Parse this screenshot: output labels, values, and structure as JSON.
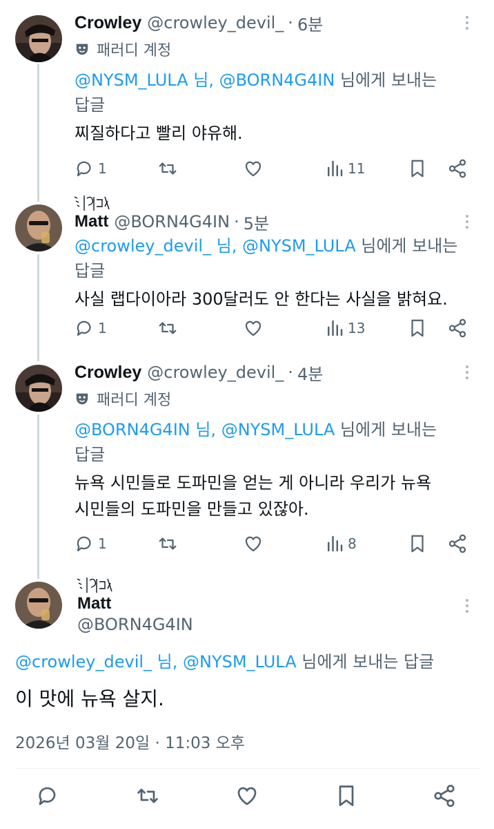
{
  "tweets": [
    {
      "display_name": "Crowley",
      "handle": "@crowley_devil_",
      "separator": "·",
      "time": "6분",
      "badge": "패러디 계정",
      "reply_mentions": "@NYSM_LULA 님, @BORN4G4IN",
      "reply_suffix": " 님에게 보내는",
      "reply_suffix2": "답글",
      "text": "찌질하다고 빨리 야유해.",
      "stats": {
        "replies": "1",
        "views": "11"
      }
    },
    {
      "display_name": "Matt",
      "handle": "@BORN4G4IN",
      "separator": "·",
      "time": "5분",
      "reply_mentions": "@crowley_devil_ 님, @NYSM_LULA",
      "reply_suffix": " 님에게 보내는",
      "reply_suffix2": "답글",
      "text": "사실 랩다이아라 300달러도 안 한다는 사실을 밝혀요.",
      "stats": {
        "replies": "1",
        "views": "13"
      }
    },
    {
      "display_name": "Crowley",
      "handle": "@crowley_devil_",
      "separator": "·",
      "time": "4분",
      "badge": "패러디 계정",
      "reply_mentions": "@BORN4G4IN 님, @NYSM_LULA",
      "reply_suffix": " 님에게 보내는",
      "reply_suffix2": "답글",
      "text_line1": "뉴욕 시민들로 도파민을 얻는 게 아니라 우리가 뉴욕",
      "text_line2": "시민들의 도파민을 만들고 있잖아.",
      "stats": {
        "replies": "1",
        "views": "8"
      }
    }
  ],
  "main_tweet": {
    "display_name": "Matt",
    "handle": "@BORN4G4IN",
    "reply_mentions": "@crowley_devil_ 님, @NYSM_LULA",
    "reply_suffix": " 님에게 보내는 답글",
    "text": "이 맛에 뉴욕 살지.",
    "timestamp": "2026년 03월 20일 · 11:03 오후"
  },
  "colors": {
    "accent": "#1d9bf0",
    "muted": "#536471",
    "text": "#0f1419",
    "line": "#cfd9de"
  },
  "icons": [
    "reply-icon",
    "retweet-icon",
    "like-icon",
    "views-icon",
    "bookmark-icon",
    "share-icon",
    "more-icon",
    "parody-mask-icon"
  ]
}
